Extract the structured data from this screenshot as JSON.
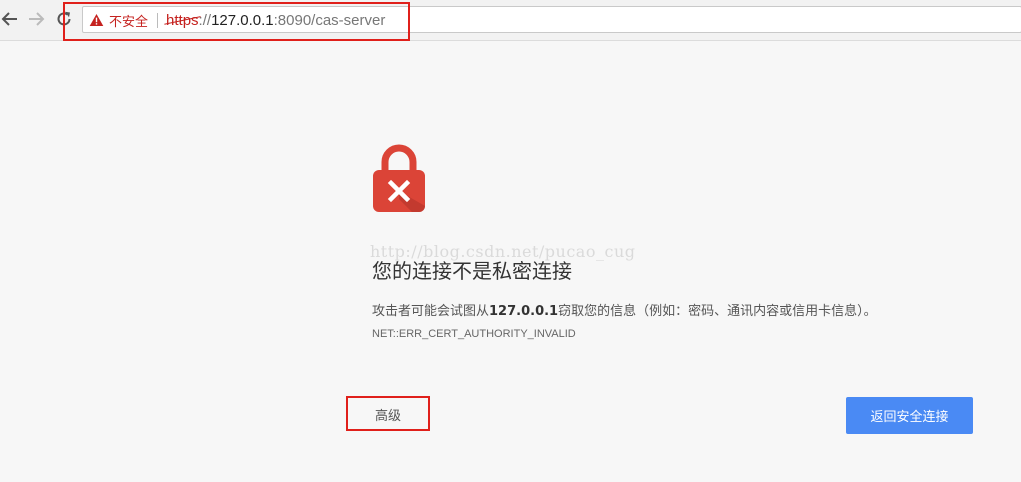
{
  "browser": {
    "back_icon": "arrow-left-icon",
    "forward_icon": "arrow-right-icon",
    "reload_icon": "reload-icon",
    "security_icon": "warning-triangle-icon",
    "security_label": "不安全",
    "url_scheme": "https",
    "url_separator": "://",
    "url_host": "127.0.0.1",
    "url_rest": ":8090/cas-server"
  },
  "interstitial": {
    "icon": "broken-lock-icon",
    "watermark": "http://blog.csdn.net/pucao_cug",
    "heading": "您的连接不是私密连接",
    "explanation_before": "攻击者可能会试图从",
    "explanation_host": "127.0.0.1",
    "explanation_after": "窃取您的信息（例如：密码、通讯内容或信用卡信息）。",
    "error_code": "NET::ERR_CERT_AUTHORITY_INVALID",
    "advanced_label": "高级",
    "back_to_safety_label": "返回安全连接"
  },
  "colors": {
    "danger_red": "#c5221f",
    "lock_red": "#db4437",
    "highlight_red": "#e0201b",
    "primary_blue": "#4a8af4",
    "page_background": "#f7f7f7"
  }
}
